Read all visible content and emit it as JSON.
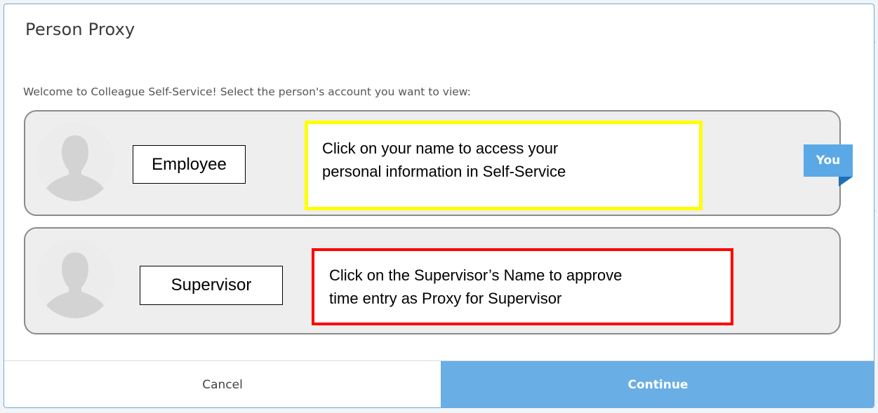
{
  "dialog": {
    "title": "Person Proxy",
    "intro": "Welcome to Colleague Self-Service! Select the person's account you want to view:"
  },
  "people": [
    {
      "name": "Employee",
      "callout_line1": "Click on your name to access your",
      "callout_line2": "personal information in Self-Service",
      "badge": "You"
    },
    {
      "name": "Supervisor",
      "callout_line1": "Click on the Supervisor’s Name to approve",
      "callout_line2": "time entry as Proxy for Supervisor"
    }
  ],
  "footer": {
    "cancel_label": "Cancel",
    "continue_label": "Continue"
  },
  "colors": {
    "accent": "#6aaee6",
    "badge": "#5aa9e6",
    "employee_callout_border": "#ffff00",
    "supervisor_callout_border": "#ff0000"
  },
  "icons": {
    "avatar": "person-silhouette-icon"
  }
}
